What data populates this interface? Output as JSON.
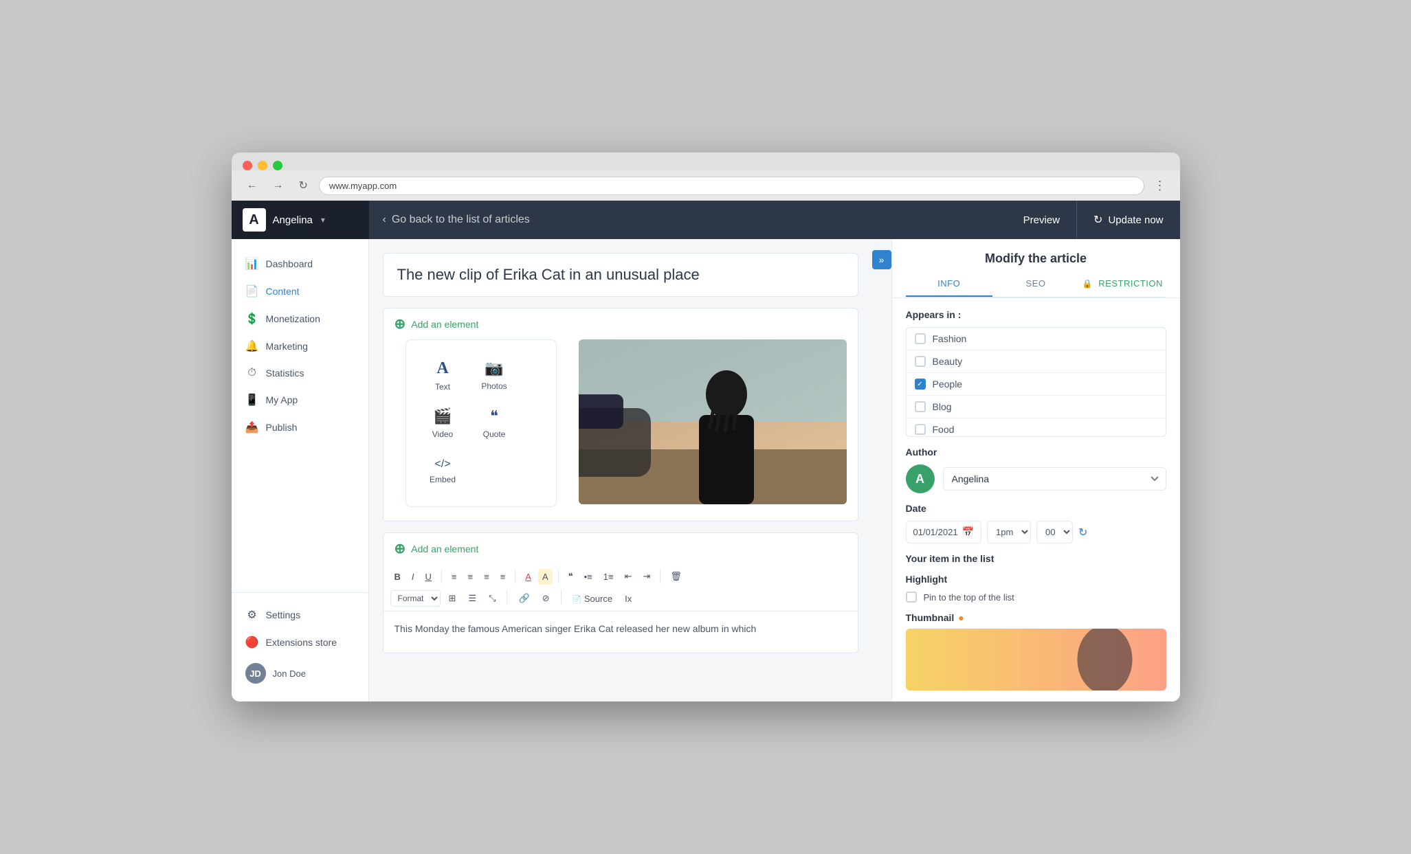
{
  "browser": {
    "url": "www.myapp.com",
    "back_icon": "←",
    "forward_icon": "→",
    "refresh_icon": "↻",
    "menu_icon": "⋮"
  },
  "header": {
    "logo_letter": "A",
    "user_name": "Angelina",
    "caret": "▾",
    "back_label": "Go back to the list of articles",
    "preview_label": "Preview",
    "update_label": "Update now",
    "refresh_icon": "↻"
  },
  "sidebar": {
    "items": [
      {
        "id": "dashboard",
        "label": "Dashboard",
        "icon": "📊"
      },
      {
        "id": "content",
        "label": "Content",
        "icon": "📄"
      },
      {
        "id": "monetization",
        "label": "Monetization",
        "icon": "💲"
      },
      {
        "id": "marketing",
        "label": "Marketing",
        "icon": "🔔"
      },
      {
        "id": "statistics",
        "label": "Statistics",
        "icon": "⏱"
      },
      {
        "id": "myapp",
        "label": "My App",
        "icon": "📱"
      },
      {
        "id": "publish",
        "label": "Publish",
        "icon": "📤"
      }
    ],
    "bottom": [
      {
        "id": "settings",
        "label": "Settings",
        "icon": "⚙"
      },
      {
        "id": "extensions",
        "label": "Extensions store",
        "icon": "🔴"
      }
    ],
    "user": {
      "name": "Jon Doe",
      "initials": "JD"
    }
  },
  "editor": {
    "article_title": "The new clip of Erika Cat in an unusual place",
    "add_element_label": "Add an element",
    "add_element_label2": "Add an element",
    "element_menu": {
      "items": [
        {
          "id": "text",
          "label": "Text",
          "icon": "A"
        },
        {
          "id": "photos",
          "label": "Photos",
          "icon": "📷"
        },
        {
          "id": "video",
          "label": "Video",
          "icon": "🎬"
        },
        {
          "id": "quote",
          "label": "Quote",
          "icon": "❝"
        },
        {
          "id": "embed",
          "label": "Embed",
          "icon": "</>"
        }
      ]
    },
    "toolbar": {
      "bold": "B",
      "italic": "I",
      "underline": "U",
      "align_left": "≡",
      "align_center": "≡",
      "align_right": "≡",
      "justify": "≡",
      "font_color": "A",
      "highlight": "A",
      "quote": "❝",
      "bullet": "•",
      "ordered": "1.",
      "indent_less": "«",
      "indent_more": "»",
      "trash": "🗑",
      "format_label": "Format",
      "grid_icon": "⊞",
      "list_icon": "☰",
      "resize_icon": "⤡",
      "link_icon": "🔗",
      "unlink_icon": "⊘",
      "source_label": "Source",
      "clear_label": "Ix"
    },
    "article_body": "This Monday the famous American singer Erika Cat released her new album in which"
  },
  "right_panel": {
    "title": "Modify the article",
    "tabs": [
      {
        "id": "info",
        "label": "INFO",
        "active": true
      },
      {
        "id": "seo",
        "label": "SEO",
        "active": false
      },
      {
        "id": "restriction",
        "label": "RESTRICTION",
        "active": false
      }
    ],
    "appears_in_label": "Appears in :",
    "categories": [
      {
        "id": "fashion",
        "label": "Fashion",
        "checked": false
      },
      {
        "id": "beauty",
        "label": "Beauty",
        "checked": false
      },
      {
        "id": "people",
        "label": "People",
        "checked": true
      },
      {
        "id": "blog",
        "label": "Blog",
        "checked": false
      },
      {
        "id": "food",
        "label": "Food",
        "checked": false
      }
    ],
    "author_label": "Author",
    "author_initial": "A",
    "author_name": "Angelina",
    "date_label": "Date",
    "date_value": "01/01/2021",
    "time_value": "1pm",
    "minutes_value": "00",
    "your_item_label": "Your item in the list",
    "highlight_label": "Highlight",
    "pin_label": "Pin to the top of the list",
    "thumbnail_label": "Thumbnail",
    "thumbnail_help_icon": "●"
  },
  "colors": {
    "sidebar_active": "#3182ce",
    "header_bg": "#2d3748",
    "green_accent": "#38a169",
    "blue_accent": "#3182ce",
    "restriction_green": "#38a169"
  }
}
